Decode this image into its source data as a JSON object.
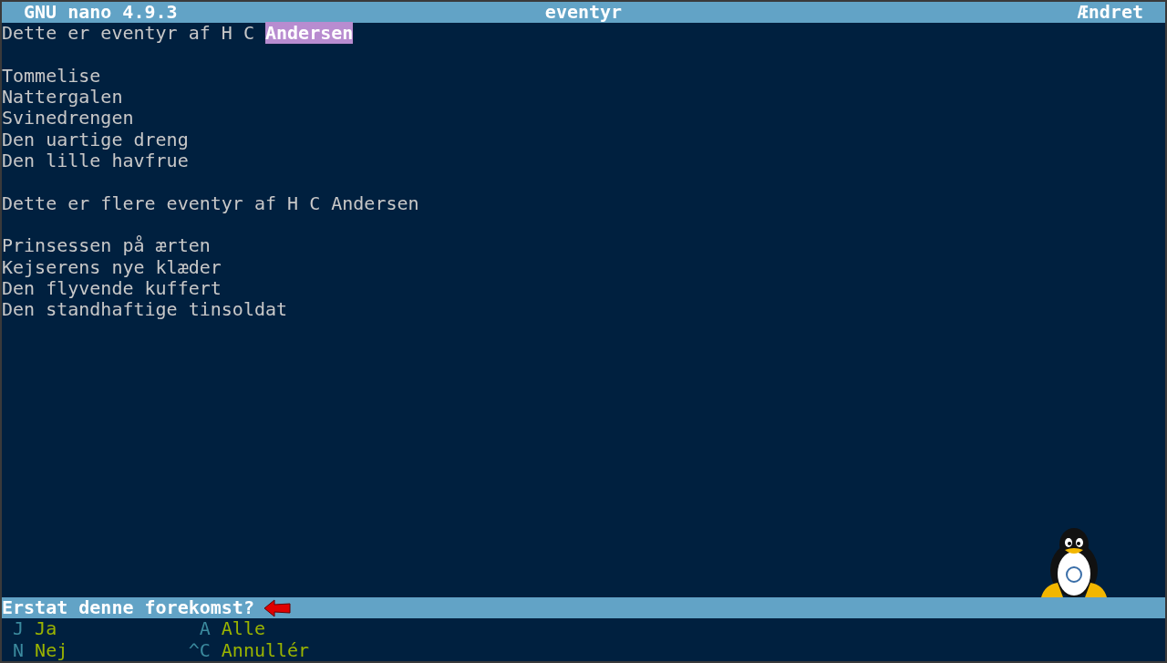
{
  "title_bar": {
    "app": "GNU nano 4.9.3",
    "file": "eventyr",
    "status": "Ændret"
  },
  "lines": [
    {
      "kind": "text",
      "segments": [
        {
          "text": "Dette er eventyr af H C ",
          "highlighted": false
        },
        {
          "text": "Andersen",
          "highlighted": true
        }
      ]
    },
    {
      "kind": "blank"
    },
    {
      "kind": "text",
      "segments": [
        {
          "text": "Tommelise",
          "highlighted": false
        }
      ]
    },
    {
      "kind": "text",
      "segments": [
        {
          "text": "Nattergalen",
          "highlighted": false
        }
      ]
    },
    {
      "kind": "text",
      "segments": [
        {
          "text": "Svinedrengen",
          "highlighted": false
        }
      ]
    },
    {
      "kind": "text",
      "segments": [
        {
          "text": "Den uartige dreng",
          "highlighted": false
        }
      ]
    },
    {
      "kind": "text",
      "segments": [
        {
          "text": "Den lille havfrue",
          "highlighted": false
        }
      ]
    },
    {
      "kind": "blank"
    },
    {
      "kind": "text",
      "segments": [
        {
          "text": "Dette er flere eventyr af H C Andersen",
          "highlighted": false
        }
      ]
    },
    {
      "kind": "blank"
    },
    {
      "kind": "text",
      "segments": [
        {
          "text": "Prinsessen på ærten",
          "highlighted": false
        }
      ]
    },
    {
      "kind": "text",
      "segments": [
        {
          "text": "Kejserens nye klæder",
          "highlighted": false
        }
      ]
    },
    {
      "kind": "text",
      "segments": [
        {
          "text": "Den flyvende kuffert",
          "highlighted": false
        }
      ]
    },
    {
      "kind": "text",
      "segments": [
        {
          "text": "Den standhaftige tinsoldat",
          "highlighted": false
        }
      ]
    }
  ],
  "prompt": "Erstat denne forekomst?",
  "shortcuts": [
    {
      "key": "J",
      "label": "Ja"
    },
    {
      "key": "A",
      "label": "Alle"
    },
    {
      "key": "N",
      "label": "Nej"
    },
    {
      "key": "^C",
      "label": "Annullér"
    }
  ]
}
